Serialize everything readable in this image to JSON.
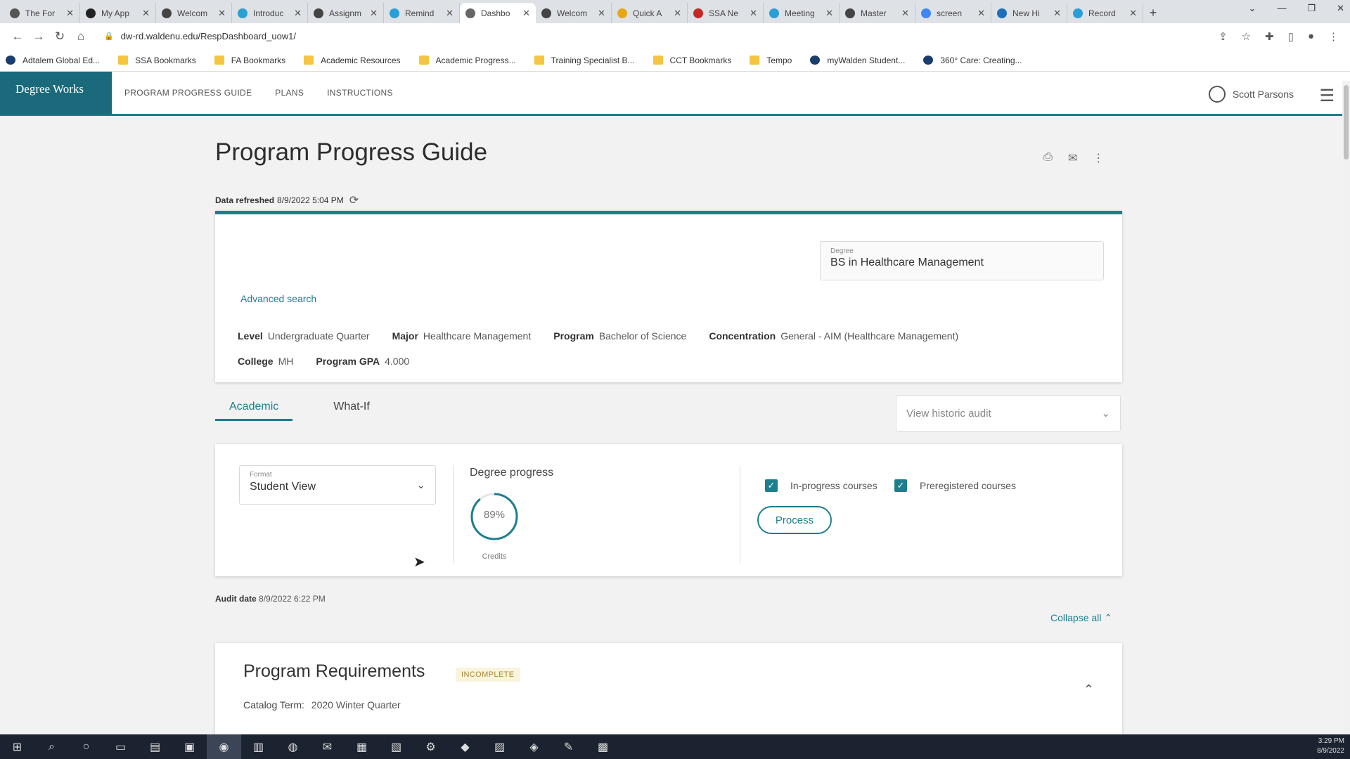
{
  "browser": {
    "tabs": [
      {
        "label": "The For",
        "icon_color": "#555555",
        "active": false
      },
      {
        "label": "My App",
        "icon_color": "#222222",
        "active": false
      },
      {
        "label": "Welcom",
        "icon_color": "#444444",
        "active": false
      },
      {
        "label": "Introduc",
        "icon_color": "#2a9fd6",
        "active": false
      },
      {
        "label": "Assignm",
        "icon_color": "#444444",
        "active": false
      },
      {
        "label": "Remind",
        "icon_color": "#2a9fd6",
        "active": false
      },
      {
        "label": "Dashbo",
        "icon_color": "#666666",
        "active": true
      },
      {
        "label": "Welcom",
        "icon_color": "#444444",
        "active": false
      },
      {
        "label": "Quick A",
        "icon_color": "#e6a817",
        "active": false
      },
      {
        "label": "SSA Ne",
        "icon_color": "#c62828",
        "active": false
      },
      {
        "label": "Meeting",
        "icon_color": "#2a9fd6",
        "active": false
      },
      {
        "label": "Master",
        "icon_color": "#444444",
        "active": false
      },
      {
        "label": "screen",
        "icon_color": "#4285f4",
        "active": false
      },
      {
        "label": "New Hi",
        "icon_color": "#1e6fb8",
        "active": false
      },
      {
        "label": "Record",
        "icon_color": "#2a9fd6",
        "active": false
      }
    ],
    "new_tab_symbol": "+",
    "url": "dw-rd.waldenu.edu/RespDashboard_uow1/"
  },
  "bookmarks": [
    {
      "label": "Adtalem Global Ed...",
      "icon": "globe-icon"
    },
    {
      "label": "SSA Bookmarks",
      "icon": "folder-icon"
    },
    {
      "label": "FA Bookmarks",
      "icon": "folder-icon"
    },
    {
      "label": "Academic Resources",
      "icon": "folder-icon"
    },
    {
      "label": "Academic Progress...",
      "icon": "folder-icon"
    },
    {
      "label": "Training Specialist B...",
      "icon": "folder-icon"
    },
    {
      "label": "CCT Bookmarks",
      "icon": "folder-icon"
    },
    {
      "label": "Tempo",
      "icon": "folder-icon"
    },
    {
      "label": "myWalden Student...",
      "icon": "globe-icon"
    },
    {
      "label": "360° Care: Creating...",
      "icon": "page-icon"
    }
  ],
  "app": {
    "logo": "Degree Works",
    "nav": [
      "PROGRAM PROGRESS GUIDE",
      "PLANS",
      "INSTRUCTIONS"
    ],
    "user_name": "Scott Parsons"
  },
  "page": {
    "title": "Program Progress Guide",
    "refreshed_label": "Data refreshed",
    "refreshed_value": "8/9/2022 5:04 PM"
  },
  "student": {
    "degree_label": "Degree",
    "degree_value": "BS in Healthcare Management",
    "advanced_search": "Advanced search",
    "row1": [
      {
        "label": "Level",
        "value": "Undergraduate Quarter"
      },
      {
        "label": "Major",
        "value": "Healthcare Management"
      },
      {
        "label": "Program",
        "value": "Bachelor of Science"
      },
      {
        "label": "Concentration",
        "value": "General - AIM (Healthcare Management)"
      }
    ],
    "row2": [
      {
        "label": "College",
        "value": "MH"
      },
      {
        "label": "Program GPA",
        "value": "4.000"
      }
    ]
  },
  "audit_tabs": [
    "Academic",
    "What-If"
  ],
  "historic_placeholder": "View historic audit",
  "audit": {
    "format_label": "Format",
    "format_value": "Student View",
    "progress_title": "Degree progress",
    "progress_percent": 89,
    "progress_text": "89%",
    "progress_caption": "Credits",
    "inprogress_label": "In-progress courses",
    "inprogress_checked": true,
    "preregistered_label": "Preregistered courses",
    "preregistered_checked": true,
    "process_label": "Process",
    "accent": "#1d7e8e"
  },
  "audit_date_label": "Audit date",
  "audit_date_value": "8/9/2022 6:22 PM",
  "collapse_all": "Collapse all",
  "requirements": {
    "title": "Program Requirements",
    "status": "INCOMPLETE",
    "catalog_label": "Catalog Term:",
    "catalog_value": "2020 Winter Quarter"
  },
  "taskbar": {
    "time": "3:29 PM",
    "date": "8/9/2022"
  }
}
